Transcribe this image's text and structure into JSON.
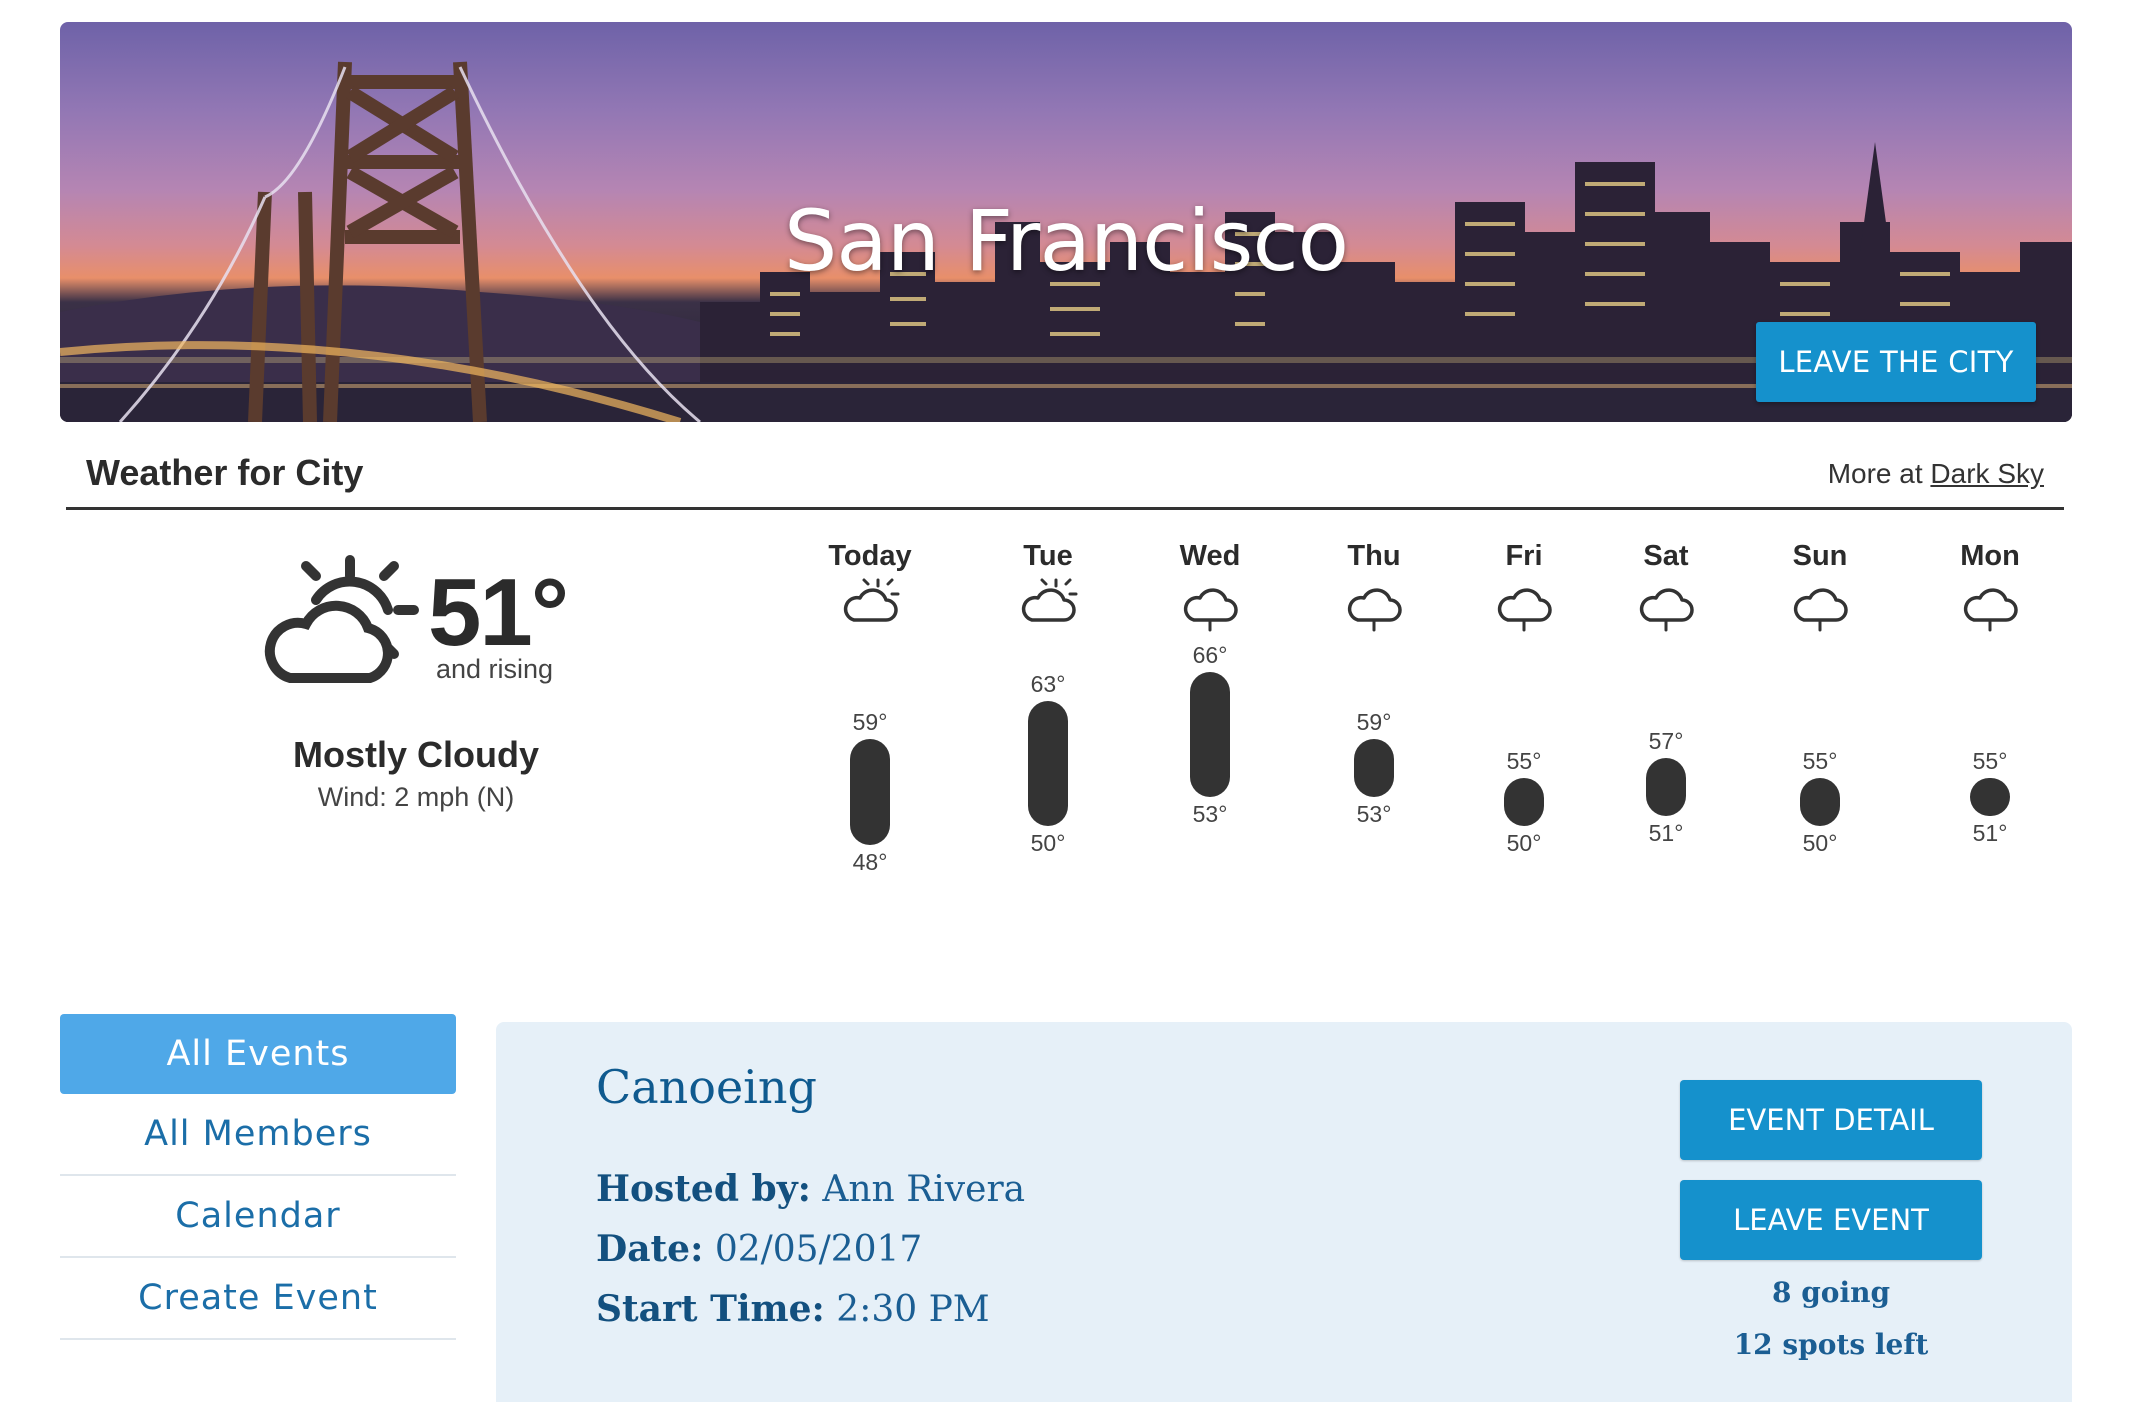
{
  "banner": {
    "city": "San Francisco",
    "leave_button": "LEAVE THE CITY"
  },
  "weather": {
    "title": "Weather for City",
    "more_prefix": "More at",
    "more_link": "Dark Sky",
    "current": {
      "icon": "partly-cloudy-icon",
      "temp": "51°",
      "trend": "and rising",
      "summary": "Mostly Cloudy",
      "wind": "Wind: 2 mph (N)"
    },
    "forecast": [
      {
        "day": "Today",
        "icon": "partly-cloudy-icon",
        "high": "59°",
        "low": "48°",
        "high_v": 59,
        "low_v": 48
      },
      {
        "day": "Tue",
        "icon": "partly-cloudy-icon",
        "high": "63°",
        "low": "50°",
        "high_v": 63,
        "low_v": 50
      },
      {
        "day": "Wed",
        "icon": "rain-icon",
        "high": "66°",
        "low": "53°",
        "high_v": 66,
        "low_v": 53
      },
      {
        "day": "Thu",
        "icon": "rain-icon",
        "high": "59°",
        "low": "53°",
        "high_v": 59,
        "low_v": 53
      },
      {
        "day": "Fri",
        "icon": "rain-icon",
        "high": "55°",
        "low": "50°",
        "high_v": 55,
        "low_v": 50
      },
      {
        "day": "Sat",
        "icon": "rain-icon",
        "high": "57°",
        "low": "51°",
        "high_v": 57,
        "low_v": 51
      },
      {
        "day": "Sun",
        "icon": "rain-icon",
        "high": "55°",
        "low": "50°",
        "high_v": 55,
        "low_v": 50
      },
      {
        "day": "Mon",
        "icon": "rain-icon",
        "high": "55°",
        "low": "51°",
        "high_v": 55,
        "low_v": 51
      }
    ]
  },
  "nav": {
    "items": [
      {
        "label": "All Events",
        "active": true
      },
      {
        "label": "All Members",
        "active": false
      },
      {
        "label": "Calendar",
        "active": false
      },
      {
        "label": "Create Event",
        "active": false
      }
    ]
  },
  "event": {
    "name": "Canoeing",
    "host_label": "Hosted by:",
    "host": "Ann Rivera",
    "date_label": "Date:",
    "date": "02/05/2017",
    "time_label": "Start Time:",
    "time": "2:30 PM",
    "detail_button": "EVENT DETAIL",
    "leave_button": "LEAVE EVENT",
    "going": "8 going",
    "spots": "12 spots left"
  },
  "colors": {
    "accent": "#1591cc",
    "nav_active": "#4fa8e8",
    "link": "#1b6ea8",
    "card_bg": "#e6f0f8"
  }
}
